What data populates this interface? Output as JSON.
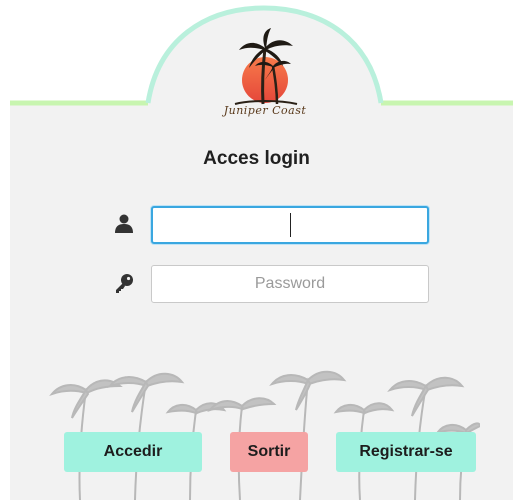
{
  "logo": {
    "text": "Juniper Coast"
  },
  "form": {
    "title": "Acces login",
    "username": {
      "value": "",
      "placeholder": "",
      "icon": "user-icon"
    },
    "password": {
      "value": "",
      "placeholder": "Password",
      "icon": "key-icon"
    }
  },
  "buttons": {
    "accedir": "Accedir",
    "sortir": "Sortir",
    "registrar": "Registrar-se"
  },
  "colors": {
    "panel_bg": "#f2f2f2",
    "arch_border": "#b9f0dc",
    "line_green": "#c8f5b0",
    "accent_teal": "#9ff2df",
    "accent_red": "#f5a3a3",
    "focus_blue": "#3aa7e0",
    "sun_orange": "#ef5a3c"
  }
}
